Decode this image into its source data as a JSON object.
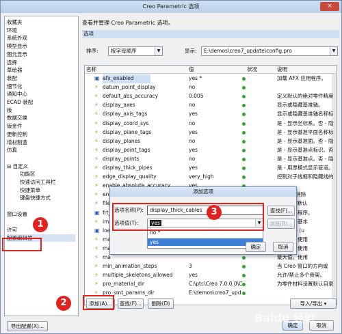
{
  "window": {
    "title": "Creo Parametric 选项",
    "close_symbol": "×"
  },
  "sidebar": {
    "items": [
      "收藏夹",
      "环境",
      "系统外观",
      "模型显示",
      "图元显示",
      "选择",
      "草绘器",
      "装配",
      "细节化",
      "通知中心",
      "ECAD 装配",
      "板",
      "数据交换",
      "钣金件",
      "更新控制",
      "增材制造",
      "仿真",
      "",
      "⊟ 自定义",
      "功能区",
      "快速访问工具栏",
      "快捷菜单",
      "键盘快捷方式",
      "",
      "窗口设置",
      "",
      "许可",
      "配置编辑器"
    ],
    "selected": "配置编辑器"
  },
  "main": {
    "description": "查看并管理 Creo Parametric 选项。",
    "section": "选项",
    "sort_label": "排序:",
    "sort_value": "按字母顺序",
    "show_label": "显示:",
    "show_value": "E:\\demos\\creo7_update\\config.pro",
    "columns": [
      "名称",
      "值",
      "状况",
      "说明"
    ],
    "rows": [
      {
        "icon": "doc",
        "name": "afx_enabled",
        "value": "yes *",
        "desc": "加载 AFX 应用程序。"
      },
      {
        "icon": "bolt",
        "name": "datum_point_display",
        "value": "no",
        "desc": ""
      },
      {
        "icon": "bolt",
        "name": "default_abs_accuracy",
        "value": "0.005",
        "desc": "定义默认的绝对零件精度"
      },
      {
        "icon": "bolt",
        "name": "display_axes",
        "value": "no",
        "desc": "显示或隐藏基准轴。"
      },
      {
        "icon": "bolt",
        "name": "display_axis_tags",
        "value": "yes",
        "desc": "显示或隐藏基准轴名称标签"
      },
      {
        "icon": "bolt",
        "name": "display_coord_sys",
        "value": "no",
        "desc": "是 - 显示坐标系。否 - 隐"
      },
      {
        "icon": "bolt",
        "name": "display_plane_tags",
        "value": "yes",
        "desc": "是 - 显示基准平面名称标"
      },
      {
        "icon": "bolt",
        "name": "display_planes",
        "value": "no",
        "desc": "是 - 显示基准面。否 - 隐"
      },
      {
        "icon": "bolt",
        "name": "display_point_tags",
        "value": "yes",
        "desc": "是 - 显示基准点标识。否"
      },
      {
        "icon": "bolt",
        "name": "display_points",
        "value": "no",
        "desc": "是 - 显示基准点。否 - 隐"
      },
      {
        "icon": "bolt",
        "name": "display_thick_pipes",
        "value": "yes",
        "desc": "是 - 用厚模式显示管道。"
      },
      {
        "icon": "bolt",
        "name": "edge_display_quality",
        "value": "very_high",
        "desc": "控制对于线框和隐藏线的"
      },
      {
        "icon": "bolt",
        "name": "enable_absolute_accuracy",
        "value": "yes",
        "desc": ""
      },
      {
        "icon": "bolt",
        "name": "ena",
        "value": "",
        "desc": "GL 全屏消除"
      },
      {
        "icon": "bolt",
        "name": "file",
        "value": "",
        "desc": "\"打开\"的默认"
      },
      {
        "icon": "doc",
        "name": "frt_",
        "value": "",
        "desc": "增到应用程序。"
      },
      {
        "icon": "bolt",
        "name": "ima",
        "value": "",
        "desc": "用或禁用基本"
      },
      {
        "icon": "doc",
        "name": "loa",
        "value": "",
        "desc": "定义文件 (u"
      },
      {
        "icon": "bolt",
        "name": "ma",
        "value": "",
        "desc": "最大值。使用"
      },
      {
        "icon": "bolt",
        "name": "ma",
        "value": "",
        "desc": "最大值。使用"
      },
      {
        "icon": "bolt",
        "name": "ma",
        "value": "",
        "desc": "最大值。使用"
      },
      {
        "icon": "bolt",
        "name": "min_animation_steps",
        "value": "3",
        "desc": "当 Creo 窗口的方向或"
      },
      {
        "icon": "bolt",
        "name": "multiple_skeletons_allowed",
        "value": "yes",
        "desc": "允许/禁止多个骨架。"
      },
      {
        "icon": "bolt",
        "name": "pro_material_dir",
        "value": "C:\\ptc\\Creo 7.0.0.0\\C",
        "desc": "为零件材料设置默认目录"
      },
      {
        "icon": "bolt",
        "name": "pro_smt_params_dir",
        "value": "E:\\demos\\creo7_upd",
        "desc": ""
      }
    ],
    "buttons": {
      "add": "添加(A)...",
      "find": "查找(F)...",
      "delete": "删除(D)",
      "import_export": "导入/导出 ▾",
      "ok": "确定",
      "cancel": "取消"
    }
  },
  "dialog": {
    "title": "添加选项",
    "name_label": "选项名称(P):",
    "name_value": "display_thick_cables",
    "value_label": "选项值(T):",
    "value_value": "yes",
    "find_btn": "查找(F)...",
    "browse_btn": "浏览(B)...",
    "ok_btn": "确定",
    "cancel_btn": "取消",
    "options": [
      "no *",
      "yes"
    ]
  },
  "footer": {
    "export": "导出配置(X)..."
  },
  "annotations": {
    "step1": "1",
    "step2": "2",
    "step3": "3"
  },
  "watermark": "Baidu 经验"
}
